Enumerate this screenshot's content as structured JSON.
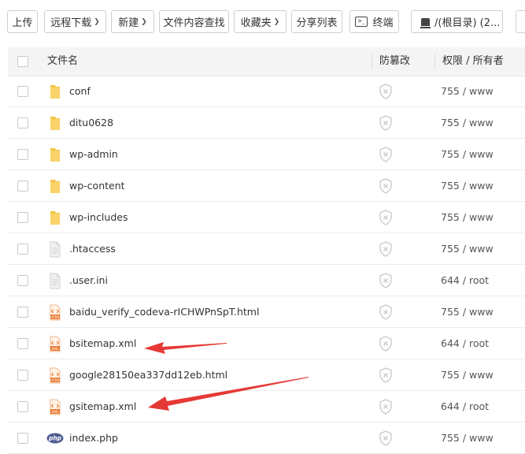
{
  "toolbar": {
    "upload": "上传",
    "remote_download": "远程下载",
    "new": "新建",
    "content_search": "文件内容查找",
    "favorites": "收藏夹",
    "share_list": "分享列表",
    "terminal": "终端",
    "path": "/(根目录) (2..."
  },
  "table": {
    "headers": {
      "name": "文件名",
      "tamper": "防篡改",
      "perm_owner": "权限 / 所有者"
    },
    "rows": [
      {
        "name": "conf",
        "type": "folder",
        "perm": "755 / www"
      },
      {
        "name": "ditu0628",
        "type": "folder",
        "perm": "755 / www"
      },
      {
        "name": "wp-admin",
        "type": "folder",
        "perm": "755 / www"
      },
      {
        "name": "wp-content",
        "type": "folder",
        "perm": "755 / www"
      },
      {
        "name": "wp-includes",
        "type": "folder",
        "perm": "755 / www"
      },
      {
        "name": ".htaccess",
        "type": "file",
        "perm": "755 / www"
      },
      {
        "name": ".user.ini",
        "type": "file",
        "perm": "644 / root"
      },
      {
        "name": "baidu_verify_codeva-rICHWPnSpT.html",
        "type": "html",
        "perm": "755 / www"
      },
      {
        "name": "bsitemap.xml",
        "type": "xml",
        "perm": "644 / root"
      },
      {
        "name": "google28150ea337dd12eb.html",
        "type": "html",
        "perm": "755 / www"
      },
      {
        "name": "gsitemap.xml",
        "type": "xml",
        "perm": "644 / root"
      },
      {
        "name": "index.php",
        "type": "php",
        "perm": "755 / www"
      }
    ]
  },
  "icon_labels": {
    "html": "HTML",
    "xml": "XML",
    "php": "php"
  },
  "colors": {
    "folder": "#f5c544",
    "arrow": "#e53935",
    "header_bg": "#f4f4f4",
    "shield": "#c8c8c8"
  }
}
